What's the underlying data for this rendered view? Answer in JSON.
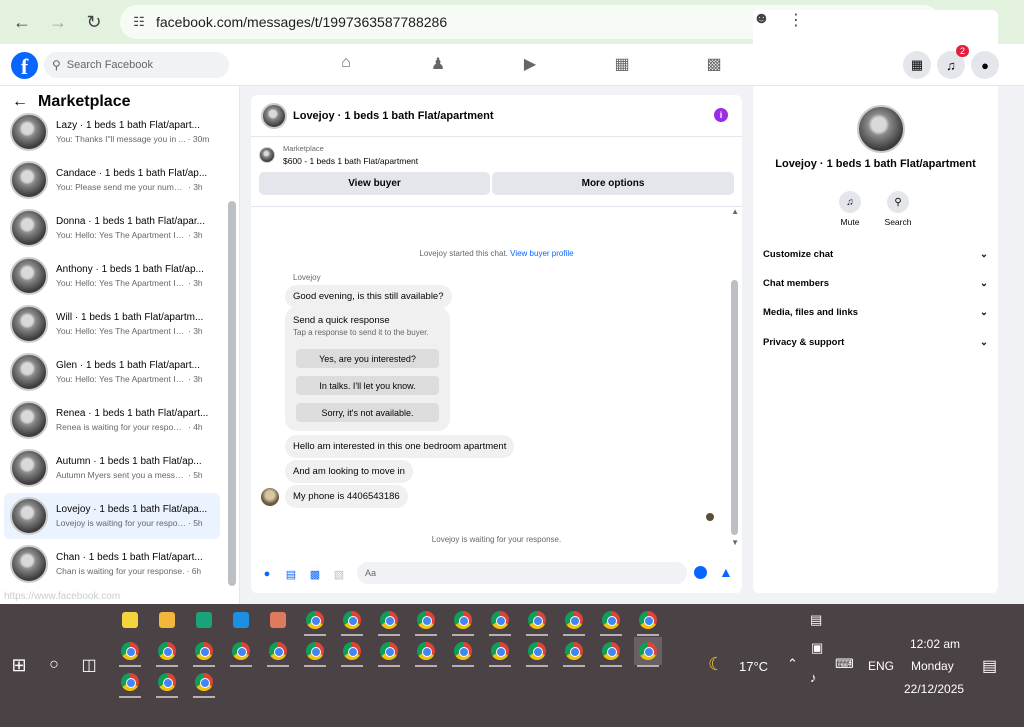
{
  "browser": {
    "url": "facebook.com/messages/t/1997363587788286"
  },
  "fb": {
    "search_placeholder": "Search Facebook",
    "notification_count": "2"
  },
  "sidebar": {
    "title": "Marketplace",
    "conversations": [
      {
        "title": "Lazy · 1 beds 1 bath Flat/apart...",
        "preview": "You: Thanks I\"ll message you in ...",
        "time": "· 30m"
      },
      {
        "title": "Candace · 1 beds 1 bath Flat/ap...",
        "preview": "You: Please send me your number...",
        "time": "· 3h"
      },
      {
        "title": "Donna · 1 beds 1 bath Flat/apar...",
        "preview": "You: Hello: Yes The Apartment Is S...",
        "time": "· 3h"
      },
      {
        "title": "Anthony · 1 beds 1 bath Flat/ap...",
        "preview": "You: Hello: Yes The Apartment Is S...",
        "time": "· 3h"
      },
      {
        "title": "Will · 1 beds 1 bath Flat/apartm...",
        "preview": "You: Hello: Yes The Apartment Is S...",
        "time": "· 3h"
      },
      {
        "title": "Glen · 1 beds 1 bath Flat/apart...",
        "preview": "You: Hello: Yes The Apartment Is S...",
        "time": "· 3h"
      },
      {
        "title": "Renea · 1 beds 1 bath Flat/apart...",
        "preview": "Renea is waiting for your response.",
        "time": "· 4h"
      },
      {
        "title": "Autumn · 1 beds 1 bath Flat/ap...",
        "preview": "Autumn Myers sent you a messag...",
        "time": "· 5h"
      },
      {
        "title": "Lovejoy · 1 beds 1 bath Flat/apa...",
        "preview": "Lovejoy is waiting for your respon...",
        "time": "· 5h"
      },
      {
        "title": "Chan · 1 beds 1 bath Flat/apart...",
        "preview": "Chan is waiting for your response.",
        "time": "· 6h"
      }
    ],
    "status_url": "https://www.facebook.com"
  },
  "chat": {
    "title": "Lovejoy · 1 beds 1 bath Flat/apartment",
    "listing_label": "Marketplace",
    "listing_price": "$600 - 1 beds 1 bath Flat/apartment",
    "view_buyer": "View buyer",
    "more_options": "More options",
    "started_text": "Lovejoy started this chat.",
    "view_profile": "View buyer profile",
    "sender": "Lovejoy",
    "msg1": "Good evening, is this still available?",
    "quick_title": "Send a quick response",
    "quick_sub": "Tap a response to send it to the buyer.",
    "quick_options": [
      "Yes, are you interested?",
      "In talks. I'll let you know.",
      "Sorry, it's not available."
    ],
    "msg2": "Hello am interested in this one bedroom apartment",
    "msg3": "And am looking to move in",
    "msg4": "My phone is 4406543186",
    "waiting": "Lovejoy is waiting for your response.",
    "composer_placeholder": "Aa"
  },
  "info": {
    "name": "Lovejoy · 1 beds 1 bath Flat/apartment",
    "mute": "Mute",
    "search": "Search",
    "sections": [
      "Customize chat",
      "Chat members",
      "Media, files and links",
      "Privacy & support"
    ]
  },
  "taskbar": {
    "weather": "17°C",
    "lang": "ENG",
    "time": "12:02 am",
    "day": "Monday",
    "date": "22/12/2025"
  }
}
